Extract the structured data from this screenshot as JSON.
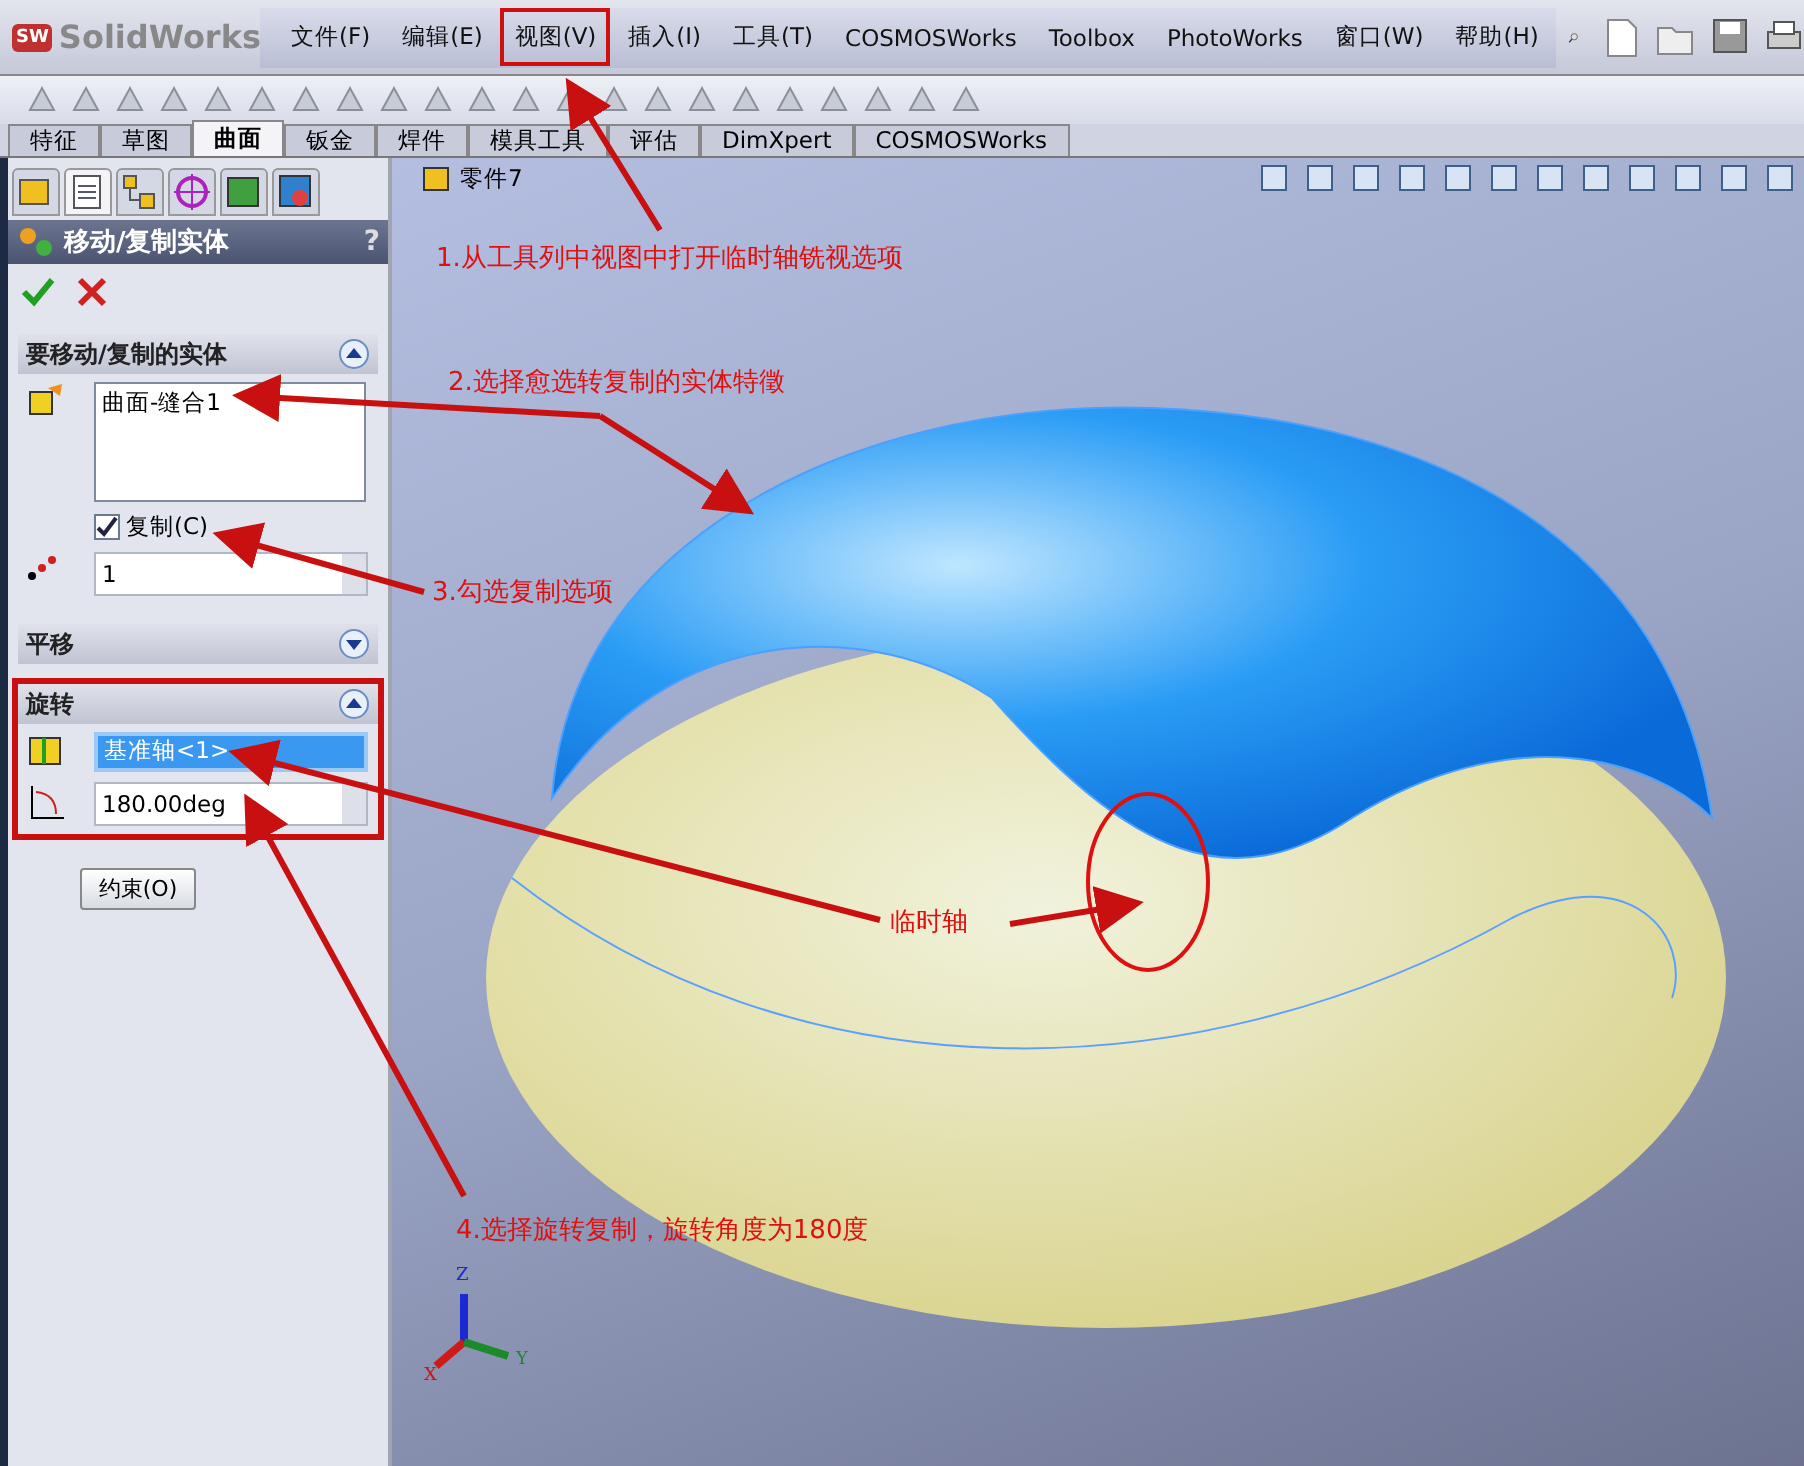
{
  "app": {
    "badge": "SW",
    "logo": "SolidWorks"
  },
  "menu": [
    {
      "label": "文件(F)",
      "highlighted": false
    },
    {
      "label": "编辑(E)",
      "highlighted": false
    },
    {
      "label": "视图(V)",
      "highlighted": true
    },
    {
      "label": "插入(I)",
      "highlighted": false
    },
    {
      "label": "工具(T)",
      "highlighted": false
    },
    {
      "label": "COSMOSWorks",
      "highlighted": false
    },
    {
      "label": "Toolbox",
      "highlighted": false
    },
    {
      "label": "PhotoWorks",
      "highlighted": false
    },
    {
      "label": "窗口(W)",
      "highlighted": false
    },
    {
      "label": "帮助(H)",
      "highlighted": false
    }
  ],
  "tabs": [
    {
      "label": "特征",
      "selected": false
    },
    {
      "label": "草图",
      "selected": false
    },
    {
      "label": "曲面",
      "selected": true
    },
    {
      "label": "钣金",
      "selected": false
    },
    {
      "label": "焊件",
      "selected": false
    },
    {
      "label": "模具工具",
      "selected": false
    },
    {
      "label": "评估",
      "selected": false
    },
    {
      "label": "DimXpert",
      "selected": false
    },
    {
      "label": "COSMOSWorks",
      "selected": false
    }
  ],
  "property_manager": {
    "title": "移动/复制实体",
    "help": "?",
    "sections": [
      {
        "kind": "bodies",
        "title": "要移动/复制的实体",
        "expanded": true,
        "highlighted": false,
        "items": [
          "曲面-缝合1"
        ],
        "copy": {
          "label": "复制(C)",
          "checked": true
        },
        "count": "1"
      },
      {
        "kind": "translate",
        "title": "平移",
        "expanded": false,
        "highlighted": false
      },
      {
        "kind": "rotate",
        "title": "旋转",
        "expanded": true,
        "highlighted": true,
        "axis": "基准轴<1>",
        "angle": "180.00deg"
      }
    ],
    "constraint_button": "约束(O)"
  },
  "viewport": {
    "tree_item": "零件7",
    "triad": [
      "X",
      "Y",
      "Z"
    ]
  },
  "annotations": [
    "1.从工具列中视图中打开临时轴铣视选项",
    "2.选择愈选转复制的实体特徵",
    "3.勾选复制选项",
    "临时轴",
    "4.选择旋转复制，旋转角度为180度"
  ]
}
